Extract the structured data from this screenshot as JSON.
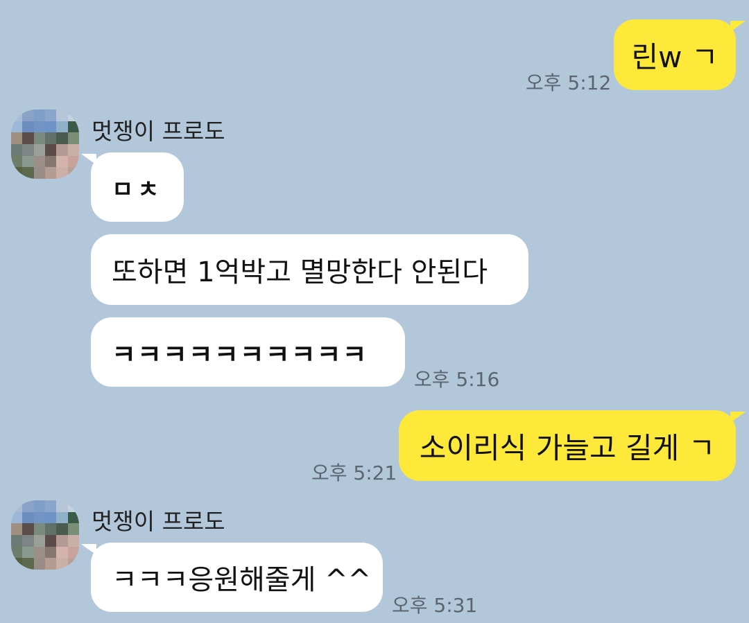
{
  "conversation": {
    "contact_name": "멋쟁이 프로도",
    "avatar_colors": [
      "#a9bcd6",
      "#8aa2c8",
      "#7f9fc8",
      "#8ba6cc",
      "#b6c5d8",
      "#c5d2de",
      "#9db7d8",
      "#6d8cbf",
      "#7393c4",
      "#6f93c6",
      "#8fb1c9",
      "#3c5a48",
      "#a08e7f",
      "#5b4d4a",
      "#7a8a7e",
      "#62706a",
      "#4a5b4f",
      "#7b8f76",
      "#6c7a74",
      "#7e8585",
      "#9aa098",
      "#5b4a4a",
      "#b59a94",
      "#c9b0a6",
      "#6d7d6a",
      "#8a9a90",
      "#9c8f89",
      "#85766f",
      "#d4b3ab",
      "#c7a39b",
      "#57613f",
      "#5d6a4e",
      "#9a8c88",
      "#b49c93",
      "#cbb0a8",
      "#b9a096"
    ],
    "messages": [
      {
        "id": "m1",
        "text": "린w ㄱ",
        "time": "오후 5:12"
      },
      {
        "id": "m2",
        "text": "ㅁㅊ"
      },
      {
        "id": "m3",
        "text": "또하면 1억박고 멸망한다 안된다"
      },
      {
        "id": "m4",
        "text": "ㅋㅋㅋㅋㅋㅋㅋㅋㅋㅋ",
        "time": "오후 5:16"
      },
      {
        "id": "m5",
        "text": "소이리식 가늘고 길게 ㄱ",
        "time": "오후 5:21"
      },
      {
        "id": "m6",
        "text": "ㅋㅋㅋ응원해줄게 ^^",
        "time": "오후 5:31"
      }
    ]
  }
}
